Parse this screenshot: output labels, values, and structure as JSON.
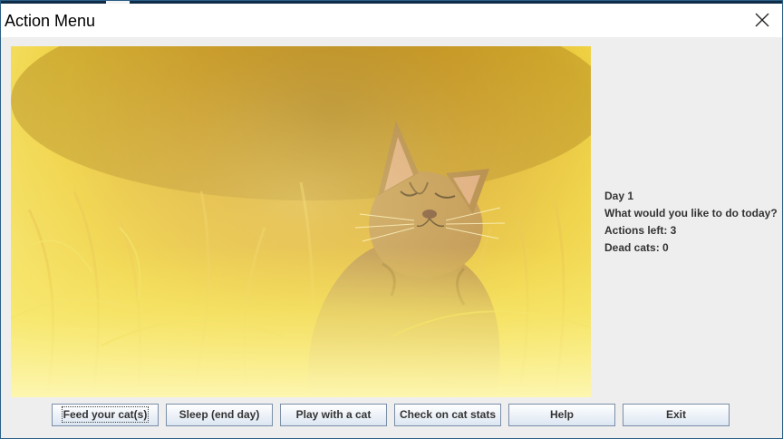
{
  "window": {
    "title": "Action Menu",
    "close_icon": "close-icon"
  },
  "image": {
    "subject": "cat-in-golden-grass-photo"
  },
  "status": {
    "day": "Day 1",
    "question": "What would you like to do today?",
    "actions_left": "Actions left: 3",
    "dead_cats": "Dead cats: 0"
  },
  "buttons": {
    "feed": "Feed your cat(s)",
    "sleep": "Sleep (end day)",
    "play": "Play with a cat",
    "stats": "Check on cat stats",
    "help": "Help",
    "exit": "Exit"
  },
  "colors": {
    "window_bg": "#eeeeee",
    "button_border": "#7a8ea8",
    "button_gradient_top": "#ffffff",
    "button_gradient_bottom": "#dce6f2"
  }
}
